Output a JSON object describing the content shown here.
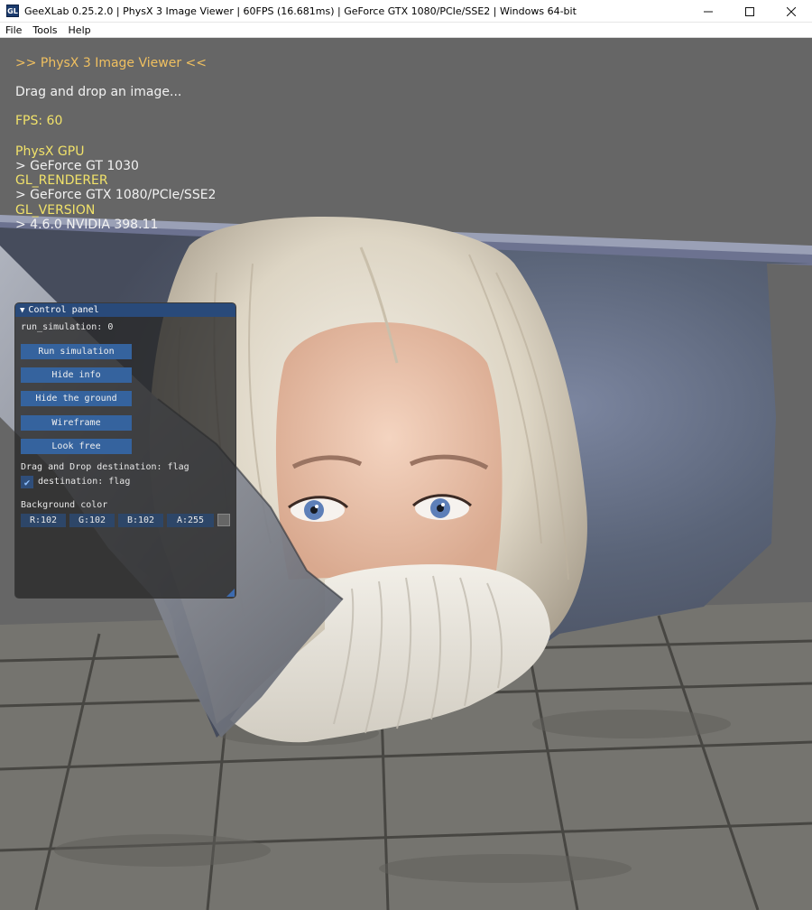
{
  "window": {
    "icon_label": "GL",
    "title": "GeeXLab 0.25.2.0 | PhysX 3 Image Viewer | 60FPS (16.681ms) | GeForce GTX 1080/PCIe/SSE2 | Windows 64-bit",
    "minimize": "—",
    "maximize": "☐",
    "close": "✕"
  },
  "menu": {
    "file": "File",
    "tools": "Tools",
    "help": "Help"
  },
  "overlay": {
    "heading": ">> PhysX 3 Image Viewer <<",
    "hint": "Drag and drop an image...",
    "fps": "FPS: 60",
    "physx_label": "PhysX GPU",
    "physx_value": "> GeForce GT 1030",
    "renderer_label": "GL_RENDERER",
    "renderer_value": "> GeForce GTX 1080/PCIe/SSE2",
    "version_label": "GL_VERSION",
    "version_value": "> 4.6.0 NVIDIA 398.11"
  },
  "panel": {
    "title": "Control panel",
    "collapse_icon": "▼",
    "status": "run_simulation: 0",
    "buttons": {
      "run": "Run simulation",
      "hide_info": "Hide info",
      "hide_ground": "Hide the ground",
      "wireframe": "Wireframe",
      "look_free": "Look free"
    },
    "dnd_label": "Drag and Drop destination: flag",
    "checkbox_label": "destination: flag",
    "checkbox_checked": true,
    "checkmark": "✔",
    "bg_label": "Background color",
    "color": {
      "r": "R:102",
      "g": "G:102",
      "b": "B:102",
      "a": "A:255",
      "swatch": "#666666"
    }
  }
}
